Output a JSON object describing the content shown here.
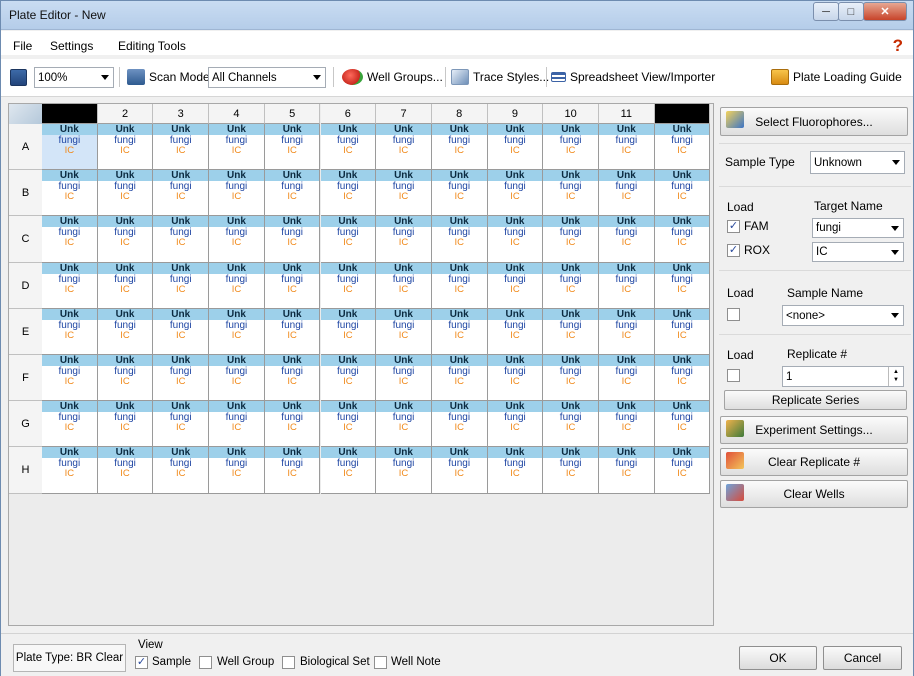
{
  "window": {
    "title": "Plate Editor - New"
  },
  "menu": {
    "file": "File",
    "settings": "Settings",
    "editing_tools": "Editing Tools",
    "help": "?"
  },
  "toolbar": {
    "zoom": "100%",
    "scan_mode_label": "Scan Mode",
    "scan_mode_value": "All Channels",
    "well_groups": "Well Groups...",
    "trace_styles": "Trace Styles...",
    "spreadsheet": "Spreadsheet View/Importer",
    "loading_guide": "Plate Loading Guide"
  },
  "plate": {
    "columns": [
      "",
      "2",
      "3",
      "4",
      "5",
      "6",
      "7",
      "8",
      "9",
      "10",
      "11",
      ""
    ],
    "rows": [
      "A",
      "B",
      "C",
      "D",
      "E",
      "F",
      "G",
      "H"
    ],
    "well_type": "Unk",
    "well_target1": "fungi",
    "well_target2": "IC",
    "selected_well": "A1"
  },
  "right_panel": {
    "select_fluorophores": "Select Fluorophores...",
    "sample_type_label": "Sample Type",
    "sample_type_value": "Unknown",
    "load_label": "Load",
    "target_name_label": "Target Name",
    "fam_label": "FAM",
    "fam_target": "fungi",
    "rox_label": "ROX",
    "rox_target": "IC",
    "load_label2": "Load",
    "sample_name_label": "Sample Name",
    "sample_name_value": "<none>",
    "load_label3": "Load",
    "replicate_label": "Replicate #",
    "replicate_value": "1",
    "replicate_series": "Replicate Series",
    "experiment_settings": "Experiment Settings...",
    "clear_replicate": "Clear Replicate #",
    "clear_wells": "Clear Wells"
  },
  "bottom": {
    "plate_type": "Plate Type: BR Clear",
    "view_label": "View",
    "sample": "Sample",
    "well_group": "Well Group",
    "biological_set": "Biological Set",
    "well_note": "Well Note",
    "ok": "OK",
    "cancel": "Cancel"
  }
}
